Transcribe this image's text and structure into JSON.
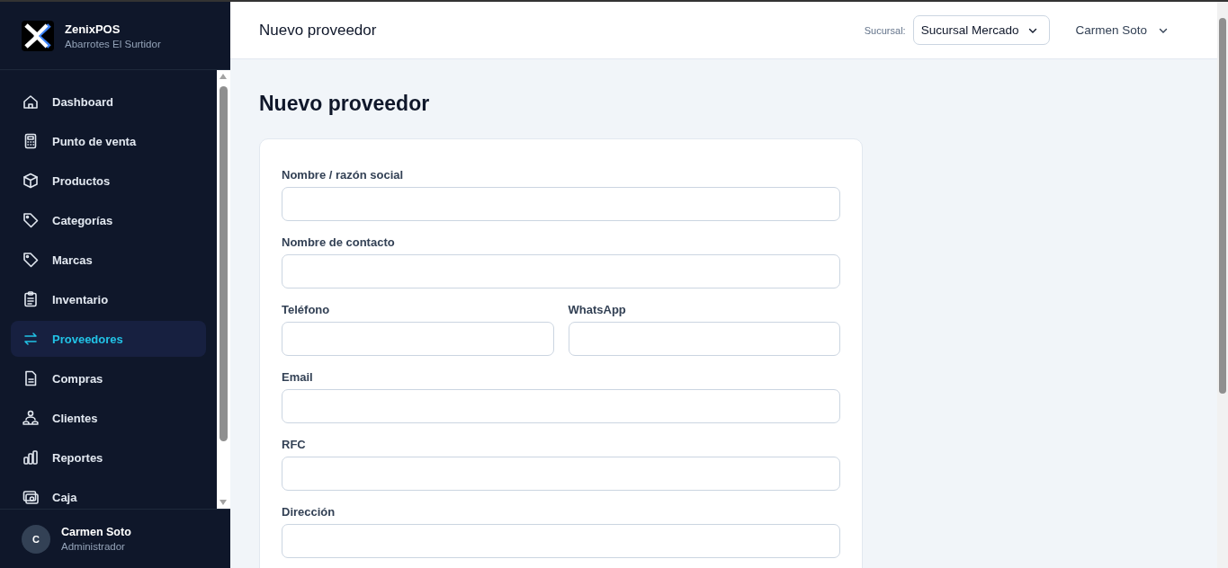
{
  "brand": {
    "name": "ZenixPOS",
    "subtitle": "Abarrotes El Surtidor"
  },
  "nav": [
    {
      "label": "Dashboard",
      "selected": false
    },
    {
      "label": "Punto de venta",
      "selected": false
    },
    {
      "label": "Productos",
      "selected": false
    },
    {
      "label": "Categorías",
      "selected": false
    },
    {
      "label": "Marcas",
      "selected": false
    },
    {
      "label": "Inventario",
      "selected": false
    },
    {
      "label": "Proveedores",
      "selected": true
    },
    {
      "label": "Compras",
      "selected": false
    },
    {
      "label": "Clientes",
      "selected": false
    },
    {
      "label": "Reportes",
      "selected": false
    },
    {
      "label": "Caja",
      "selected": false
    }
  ],
  "user": {
    "initial": "C",
    "name": "Carmen Soto",
    "role": "Administrador"
  },
  "header": {
    "title": "Nuevo proveedor",
    "branch_label": "Sucursal:",
    "branch": "Sucursal Mercado",
    "user": "Carmen Soto"
  },
  "page_title": "Nuevo proveedor",
  "form_rows": [
    {
      "fields": [
        {
          "label": "Nombre / razón social"
        }
      ]
    },
    {
      "fields": [
        {
          "label": "Nombre de contacto"
        }
      ]
    },
    {
      "fields": [
        {
          "label": "Teléfono"
        },
        {
          "label": "WhatsApp"
        }
      ]
    },
    {
      "fields": [
        {
          "label": "Email"
        }
      ]
    },
    {
      "fields": [
        {
          "label": "RFC"
        }
      ]
    },
    {
      "fields": [
        {
          "label": "Dirección"
        }
      ]
    }
  ]
}
